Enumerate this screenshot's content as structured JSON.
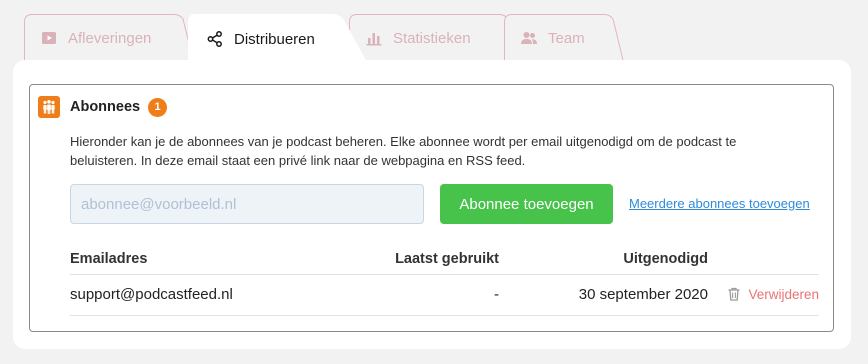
{
  "tabs": [
    {
      "label": "Afleveringen",
      "icon": "play-square-icon",
      "active": false
    },
    {
      "label": "Distribueren",
      "icon": "share-icon",
      "active": true
    },
    {
      "label": "Statistieken",
      "icon": "bar-chart-icon",
      "active": false
    },
    {
      "label": "Team",
      "icon": "users-icon",
      "active": false
    }
  ],
  "colors": {
    "accent": "#ef7d1a",
    "primary_button": "#47c24a",
    "link": "#2f8bd8",
    "danger": "#e87474",
    "inactive_tab_text": "#d9b3b8"
  },
  "panel": {
    "icon": "people-icon",
    "title": "Abonnees",
    "count": "1",
    "description": "Hieronder kan je de abonnees van je podcast beheren. Elke abonnee wordt per email uitgenodigd om de podcast te beluisteren. In deze email staat een privé link naar de webpagina en RSS feed."
  },
  "form": {
    "email_value": "",
    "email_placeholder": "abonnee@voorbeeld.nl",
    "add_button_label": "Abonnee toevoegen",
    "multi_link_label": "Meerdere abonnees toevoegen"
  },
  "table": {
    "headers": {
      "email": "Emailadres",
      "last_used": "Laatst gebruikt",
      "invited": "Uitgenodigd"
    },
    "rows": [
      {
        "email": "support@podcastfeed.nl",
        "last_used": "-",
        "invited": "30 september 2020",
        "delete_label": "Verwijderen",
        "delete_icon": "trash-icon"
      }
    ]
  }
}
